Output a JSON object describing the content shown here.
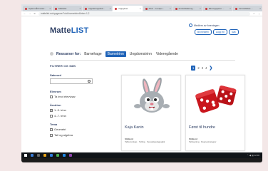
{
  "browser": {
    "tabs": [
      {
        "label": "Spørsmål fra lær...",
        "active": false
      },
      {
        "label": "Mattelist",
        "active": false
      },
      {
        "label": "Opplæringsbok...",
        "active": false
      },
      {
        "label": "Oppgaver",
        "active": true
      },
      {
        "label": "Arkiv - Lenapo...",
        "active": false
      },
      {
        "label": "Innholdslæring...",
        "active": false
      },
      {
        "label": "Elevoppgaver ...",
        "active": false
      },
      {
        "label": "Innholdsliste ...",
        "active": false
      }
    ],
    "url": "mattelist.no/oppgaver/?utd=barnetrinn&trinn=1,2"
  },
  "site": {
    "logo_main": "Matte",
    "logo_accent": "LIST",
    "login_title": "Medlem av foreningen",
    "login_buttons": [
      "Bli medlem",
      "Logg inn",
      "Søk"
    ]
  },
  "resource_nav": {
    "label": "Ressurser for:",
    "items": [
      {
        "label": "Barnehage",
        "active": false
      },
      {
        "label": "Barnetrinn",
        "active": true
      },
      {
        "label": "Ungdomstrinn",
        "active": false
      },
      {
        "label": "Videregående",
        "active": false
      }
    ]
  },
  "sidebar": {
    "heading": "FILTRER OG SØK",
    "search_label": "Søkeord",
    "search_placeholder": "",
    "elevrom_label": "Elevrom",
    "elevrom_option": "Ta imot elevvisar",
    "trinn_label": "Årstrinn",
    "trinn_options": [
      {
        "label": "1.-3. trinn",
        "checked": true
      },
      {
        "label": "4.-7. trinn",
        "checked": false
      }
    ],
    "tema_label": "Tema",
    "tema_options": [
      {
        "label": "Geometri",
        "checked": false
      },
      {
        "label": "Tall og algebra",
        "checked": false
      }
    ]
  },
  "pager": {
    "pages": [
      "1",
      "2",
      "3",
      "4"
    ],
    "active": "1",
    "next": "❯"
  },
  "cards": [
    {
      "title": "Kaja Kanin",
      "meta_label": "Stikkord",
      "meta_value": "Tallkunnskap · Telling · Spesialpedagogikk"
    },
    {
      "title": "Først til hundre",
      "meta_label": "Stikkord",
      "meta_value": "Tallregning · Regnestrategier"
    }
  ],
  "taskbar": {
    "tray": "⌃ ◀ ▤ 12:00"
  }
}
